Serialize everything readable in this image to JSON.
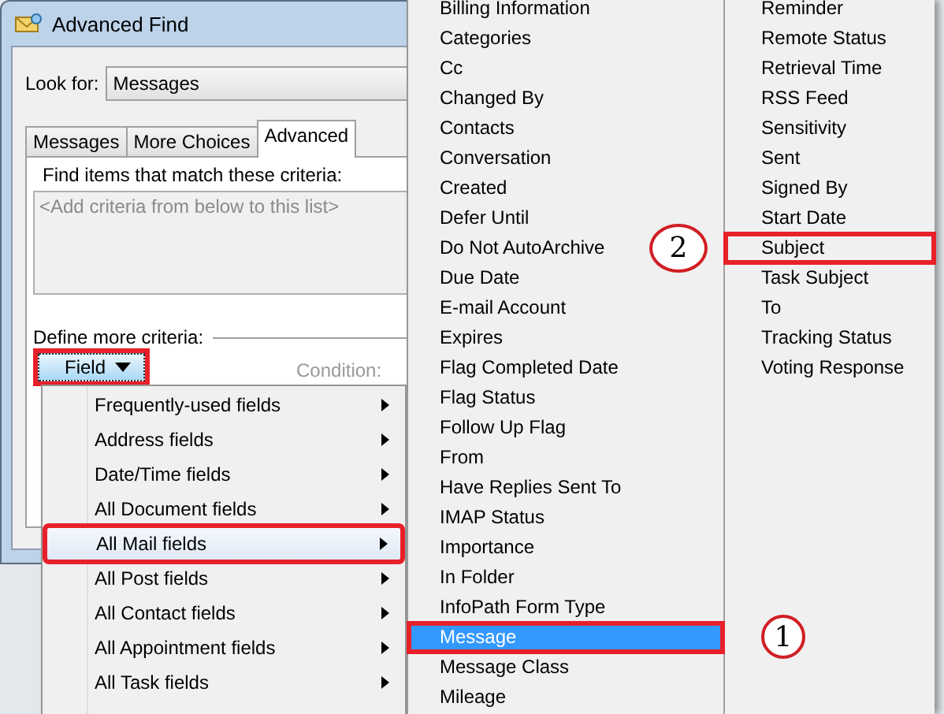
{
  "window": {
    "title": "Advanced Find"
  },
  "look_for": {
    "label": "Look for:",
    "value": "Messages"
  },
  "tabs": [
    {
      "label": "Messages",
      "selected": false
    },
    {
      "label": "More Choices",
      "selected": false
    },
    {
      "label": "Advanced",
      "selected": true
    }
  ],
  "criteria": {
    "label": "Find items that match these criteria:",
    "empty_text": "<Add criteria from below to this list>"
  },
  "define_more": {
    "label": "Define more criteria:"
  },
  "field_button": {
    "label": "Field",
    "annotated": true
  },
  "condition": {
    "label": "Condition:",
    "disabled": true
  },
  "field_menu": {
    "items": [
      {
        "label": "Frequently-used fields",
        "selected": false,
        "annotated": false
      },
      {
        "label": "Address fields",
        "selected": false,
        "annotated": false
      },
      {
        "label": "Date/Time fields",
        "selected": false,
        "annotated": false
      },
      {
        "label": "All Document fields",
        "selected": false,
        "annotated": false
      },
      {
        "label": "All Mail fields",
        "selected": true,
        "annotated": true
      },
      {
        "label": "All Post fields",
        "selected": false,
        "annotated": false
      },
      {
        "label": "All Contact fields",
        "selected": false,
        "annotated": false
      },
      {
        "label": "All Appointment fields",
        "selected": false,
        "annotated": false
      },
      {
        "label": "All Task fields",
        "selected": false,
        "annotated": false
      }
    ]
  },
  "mail_fields_menu": {
    "columns": [
      [
        {
          "label": "Billing Information",
          "selected": false,
          "annotated": false
        },
        {
          "label": "Categories",
          "selected": false,
          "annotated": false
        },
        {
          "label": "Cc",
          "selected": false,
          "annotated": false
        },
        {
          "label": "Changed By",
          "selected": false,
          "annotated": false
        },
        {
          "label": "Contacts",
          "selected": false,
          "annotated": false
        },
        {
          "label": "Conversation",
          "selected": false,
          "annotated": false
        },
        {
          "label": "Created",
          "selected": false,
          "annotated": false
        },
        {
          "label": "Defer Until",
          "selected": false,
          "annotated": false
        },
        {
          "label": "Do Not AutoArchive",
          "selected": false,
          "annotated": false
        },
        {
          "label": "Due Date",
          "selected": false,
          "annotated": false
        },
        {
          "label": "E-mail Account",
          "selected": false,
          "annotated": false
        },
        {
          "label": "Expires",
          "selected": false,
          "annotated": false
        },
        {
          "label": "Flag Completed Date",
          "selected": false,
          "annotated": false
        },
        {
          "label": "Flag Status",
          "selected": false,
          "annotated": false
        },
        {
          "label": "Follow Up Flag",
          "selected": false,
          "annotated": false
        },
        {
          "label": "From",
          "selected": false,
          "annotated": false
        },
        {
          "label": "Have Replies Sent To",
          "selected": false,
          "annotated": false
        },
        {
          "label": "IMAP Status",
          "selected": false,
          "annotated": false
        },
        {
          "label": "Importance",
          "selected": false,
          "annotated": false
        },
        {
          "label": "In Folder",
          "selected": false,
          "annotated": false
        },
        {
          "label": "InfoPath Form Type",
          "selected": false,
          "annotated": false
        },
        {
          "label": "Message",
          "selected": true,
          "annotated": true,
          "callout": "1"
        },
        {
          "label": "Message Class",
          "selected": false,
          "annotated": false
        },
        {
          "label": "Mileage",
          "selected": false,
          "annotated": false
        }
      ],
      [
        {
          "label": "Reminder",
          "selected": false,
          "annotated": false
        },
        {
          "label": "Remote Status",
          "selected": false,
          "annotated": false
        },
        {
          "label": "Retrieval Time",
          "selected": false,
          "annotated": false
        },
        {
          "label": "RSS Feed",
          "selected": false,
          "annotated": false
        },
        {
          "label": "Sensitivity",
          "selected": false,
          "annotated": false
        },
        {
          "label": "Sent",
          "selected": false,
          "annotated": false
        },
        {
          "label": "Signed By",
          "selected": false,
          "annotated": false
        },
        {
          "label": "Start Date",
          "selected": false,
          "annotated": false
        },
        {
          "label": "Subject",
          "selected": false,
          "annotated": true,
          "callout": "2"
        },
        {
          "label": "Task Subject",
          "selected": false,
          "annotated": false
        },
        {
          "label": "To",
          "selected": false,
          "annotated": false
        },
        {
          "label": "Tracking Status",
          "selected": false,
          "annotated": false
        },
        {
          "label": "Voting Response",
          "selected": false,
          "annotated": false
        }
      ]
    ]
  }
}
